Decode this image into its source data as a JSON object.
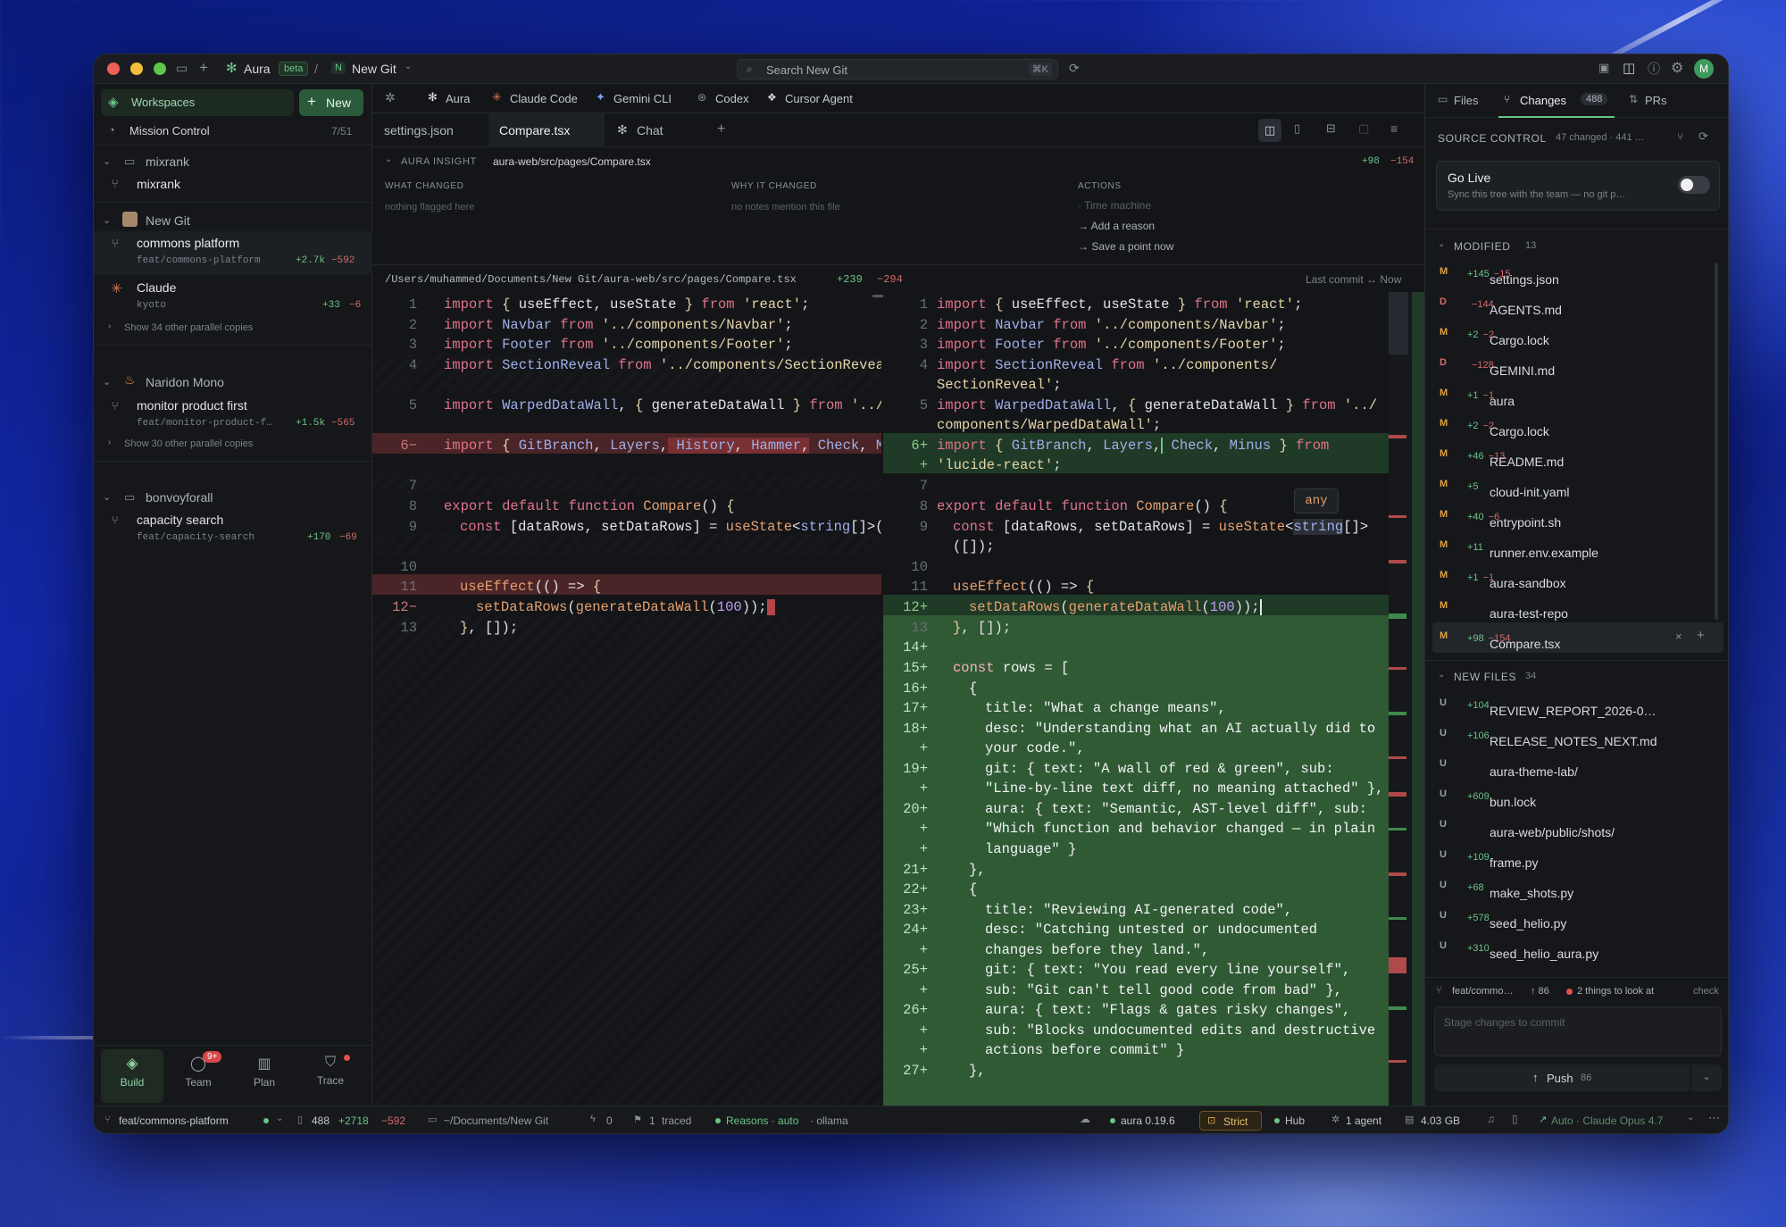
{
  "titlebar": {
    "app": "Aura",
    "beta": "beta",
    "sep": "/",
    "repo_initial": "N",
    "repo": "New Git",
    "search_placeholder": "Search New Git",
    "search_kbd": "⌘K",
    "avatar": "M"
  },
  "sidebar": {
    "workspaces": "Workspaces",
    "new_btn": "New",
    "mission": "Mission Control",
    "mission_count": "7/51",
    "groups": [
      {
        "name": "mixrank",
        "items": [
          {
            "name": "mixrank"
          }
        ]
      },
      {
        "name": "New Git",
        "items": [
          {
            "name": "commons platform",
            "branch": "feat/commons-platform",
            "add": "+2.7k",
            "del": "−592"
          },
          {
            "name": "Claude",
            "branch": "kyoto",
            "add": "+33",
            "del": "−6"
          }
        ],
        "more": "Show 34 other parallel copies"
      },
      {
        "name": "Naridon Mono",
        "items": [
          {
            "name": "monitor product first",
            "branch": "feat/monitor-product-f…",
            "add": "+1.5k",
            "del": "−565"
          }
        ],
        "more": "Show 30 other parallel copies"
      },
      {
        "name": "bonvoyforall",
        "items": [
          {
            "name": "capacity search",
            "branch": "feat/capacity-search",
            "add": "+170",
            "del": "−69"
          }
        ]
      }
    ],
    "nav": [
      {
        "label": "Build"
      },
      {
        "label": "Team",
        "badge": "9+"
      },
      {
        "label": "Plan"
      },
      {
        "label": "Trace"
      }
    ]
  },
  "agents": [
    {
      "label": "Aura"
    },
    {
      "label": "Claude Code"
    },
    {
      "label": "Gemini CLI"
    },
    {
      "label": "Codex"
    },
    {
      "label": "Cursor Agent"
    }
  ],
  "tabs": [
    {
      "label": "settings.json"
    },
    {
      "label": "Compare.tsx"
    },
    {
      "label": "Chat"
    }
  ],
  "insight": {
    "title": "AURA INSIGHT",
    "path": "aura-web/src/pages/Compare.tsx",
    "add": "+98",
    "del": "−154",
    "what_h": "WHAT CHANGED",
    "what": "nothing flagged here",
    "why_h": "WHY IT CHANGED",
    "why": "no notes mention this file",
    "actions_h": "ACTIONS",
    "actions": [
      "· Time machine",
      "→ Add a reason",
      "→ Save a point now"
    ]
  },
  "diff": {
    "path": "/Users/muhammed/Documents/New Git/aura-web/src/pages/Compare.tsx",
    "add": "+239",
    "del": "−294",
    "last": "Last commit ↔ Now",
    "tooltip": "any"
  },
  "right": {
    "tabs": [
      {
        "label": "Files"
      },
      {
        "label": "Changes",
        "count": "488"
      },
      {
        "label": "PRs"
      }
    ],
    "sc_title": "SOURCE CONTROL",
    "sc_sub": "47 changed · 441 …",
    "golive": "Go Live",
    "golive_sub": "Sync this tree with the team — no git p…",
    "modified_h": "MODIFIED",
    "modified_n": "13",
    "modified": [
      {
        "s": "M",
        "n": "settings.json",
        "a": "+145",
        "d": "−15"
      },
      {
        "s": "D",
        "n": "AGENTS.md",
        "a": "",
        "d": "−144"
      },
      {
        "s": "M",
        "n": "Cargo.lock",
        "a": "+2",
        "d": "−2"
      },
      {
        "s": "D",
        "n": "GEMINI.md",
        "a": "",
        "d": "−128"
      },
      {
        "s": "M",
        "n": "aura",
        "a": "+1",
        "d": "−1"
      },
      {
        "s": "M",
        "n": "Cargo.lock",
        "a": "+2",
        "d": "−2"
      },
      {
        "s": "M",
        "n": "README.md",
        "a": "+46",
        "d": "−13"
      },
      {
        "s": "M",
        "n": "cloud-init.yaml",
        "a": "+5",
        "d": ""
      },
      {
        "s": "M",
        "n": "entrypoint.sh",
        "a": "+40",
        "d": "−6"
      },
      {
        "s": "M",
        "n": "runner.env.example",
        "a": "+11",
        "d": ""
      },
      {
        "s": "M",
        "n": "aura-sandbox",
        "a": "+1",
        "d": "−1"
      },
      {
        "s": "M",
        "n": "aura-test-repo",
        "a": "",
        "d": ""
      },
      {
        "s": "M",
        "n": "Compare.tsx",
        "a": "+98",
        "d": "−154"
      }
    ],
    "new_h": "NEW FILES",
    "new_n": "34",
    "newfiles": [
      {
        "s": "U",
        "n": "REVIEW_REPORT_2026-0…",
        "a": "+104"
      },
      {
        "s": "U",
        "n": "RELEASE_NOTES_NEXT.md",
        "a": "+106"
      },
      {
        "s": "U",
        "n": "aura-theme-lab/",
        "a": ""
      },
      {
        "s": "U",
        "n": "bun.lock",
        "a": "+609"
      },
      {
        "s": "U",
        "n": "aura-web/public/shots/",
        "a": ""
      },
      {
        "s": "U",
        "n": "frame.py",
        "a": "+109"
      },
      {
        "s": "U",
        "n": "make_shots.py",
        "a": "+68"
      },
      {
        "s": "U",
        "n": "seed_helio.py",
        "a": "+578"
      },
      {
        "s": "U",
        "n": "seed_helio_aura.py",
        "a": "+310"
      }
    ],
    "branch": "feat/commo…",
    "ahead": "↑ 86",
    "look": "2 things to look at",
    "check": "check",
    "commit_ph": "Stage changes to commit",
    "push": "Push",
    "push_n": "86"
  },
  "status": {
    "branch": "feat/commons-platform",
    "files": "488",
    "add": "+2718",
    "del": "−592",
    "path": "~/Documents/New Git",
    "bolt": "0",
    "traced_n": "1",
    "traced": "traced",
    "reasons": "Reasons · auto",
    "ollama": "· ollama",
    "ver": "aura 0.19.6",
    "strict": "Strict",
    "hub": "Hub",
    "agent": "1 agent",
    "mem": "4.03 GB",
    "model": "Auto · Claude Opus 4.7"
  },
  "colors": {
    "accent": "#6cc486",
    "added_bg": "#2f5a34",
    "removed_bg": "#5a2a2c",
    "bg": "#16181c"
  }
}
